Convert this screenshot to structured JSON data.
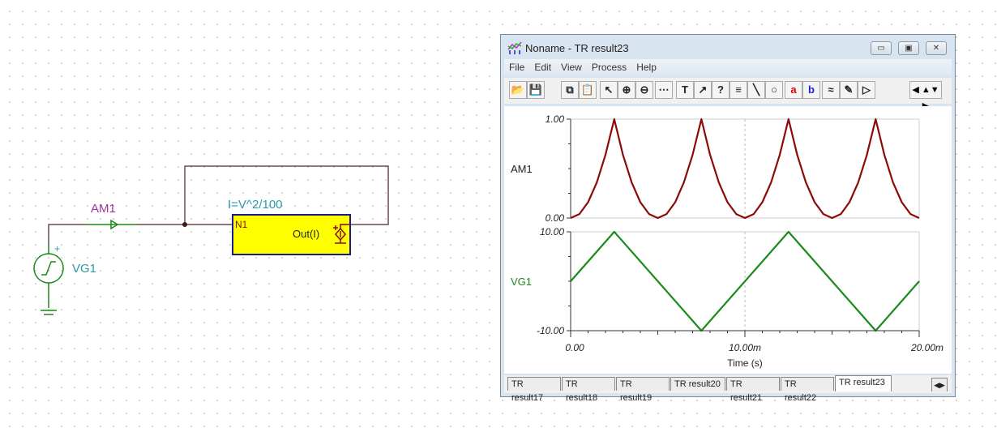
{
  "schematic": {
    "ammeter_label": "AM1",
    "source_label": "VG1",
    "source_polarity": "+",
    "block_formula": "I=V^2/100",
    "block_pin": "N1",
    "block_output": "Out(I)",
    "colors": {
      "wire": "#6b4a4a",
      "component": "#1a8a1a",
      "block_fill": "#ffff00",
      "block_border": "#1a1a8a",
      "label_teal": "#2a9aa8",
      "label_purple": "#a030a0"
    }
  },
  "window": {
    "title": "Noname - TR result23",
    "controls": {
      "minimize": "▭",
      "maximize": "▣",
      "close": "✕"
    },
    "menu": [
      "File",
      "Edit",
      "View",
      "Process",
      "Help"
    ],
    "toolbar": [
      "open-folder",
      "save",
      "copy",
      "paste",
      "select-arrow",
      "zoom-in",
      "zoom-100",
      "grid",
      "text",
      "label-curve",
      "label-question",
      "label-legend",
      "line",
      "circle",
      "cursor-a",
      "cursor-b",
      "add-curve",
      "add-probe",
      "pointer-flag"
    ],
    "tabs": [
      "TR result17",
      "TR result18",
      "TR result19",
      "TR result20",
      "TR result21",
      "TR result22",
      "TR result23"
    ],
    "active_tab": "TR result23"
  },
  "chart_data": [
    {
      "type": "line",
      "ylabel": "AM1",
      "ylim": [
        0,
        1
      ],
      "xlim": [
        0,
        0.02
      ],
      "yticks": [
        "0.00",
        "1.00"
      ],
      "color": "#8b0a0a",
      "x": [
        0,
        0.0005,
        0.001,
        0.0015,
        0.002,
        0.0025,
        0.003,
        0.0035,
        0.004,
        0.0045,
        0.005,
        0.0055,
        0.006,
        0.0065,
        0.007,
        0.0075,
        0.008,
        0.0085,
        0.009,
        0.0095,
        0.01,
        0.0105,
        0.011,
        0.0115,
        0.012,
        0.0125,
        0.013,
        0.0135,
        0.014,
        0.0145,
        0.015,
        0.0155,
        0.016,
        0.0165,
        0.017,
        0.0175,
        0.018,
        0.0185,
        0.019,
        0.0195,
        0.02
      ],
      "values": [
        0,
        0.04,
        0.16,
        0.36,
        0.64,
        1,
        0.64,
        0.36,
        0.16,
        0.04,
        0,
        0.04,
        0.16,
        0.36,
        0.64,
        1,
        0.64,
        0.36,
        0.16,
        0.04,
        0,
        0.04,
        0.16,
        0.36,
        0.64,
        1,
        0.64,
        0.36,
        0.16,
        0.04,
        0,
        0.04,
        0.16,
        0.36,
        0.64,
        1,
        0.64,
        0.36,
        0.16,
        0.04,
        0
      ]
    },
    {
      "type": "line",
      "ylabel": "VG1",
      "ylim": [
        -10,
        10
      ],
      "xlim": [
        0,
        0.02
      ],
      "yticks": [
        "-10.00",
        "10.00"
      ],
      "xticks": [
        "0.00",
        "10.00m",
        "20.00m"
      ],
      "xlabel": "Time (s)",
      "color": "#1a8a1a",
      "x": [
        0,
        0.0025,
        0.0075,
        0.0125,
        0.0175,
        0.02
      ],
      "values": [
        0,
        10,
        -10,
        10,
        -10,
        0
      ]
    }
  ]
}
